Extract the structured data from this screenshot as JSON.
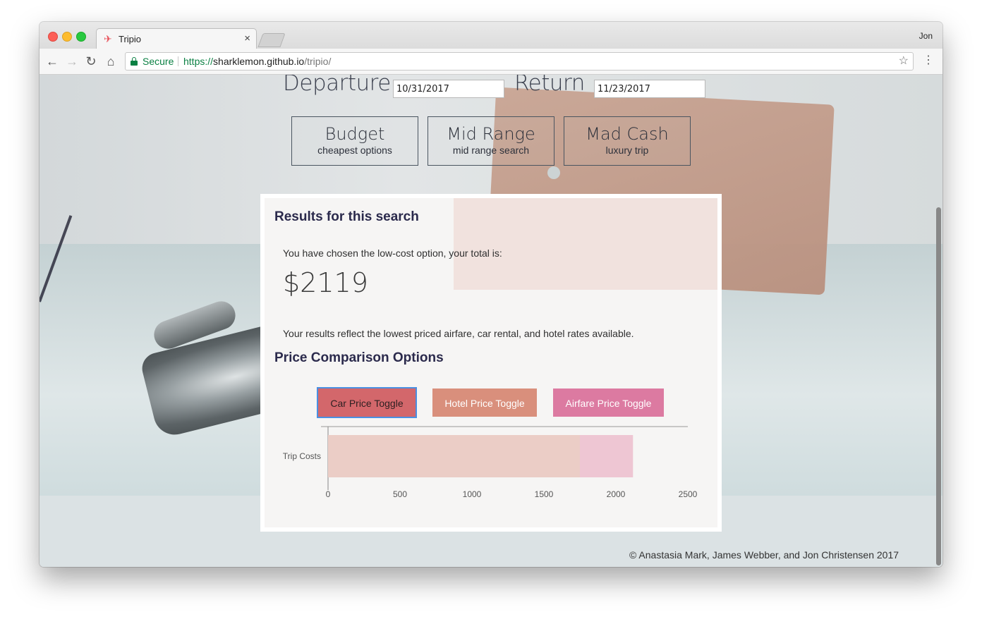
{
  "browser": {
    "tab_title": "Tripio",
    "profile": "Jon",
    "secure_label": "Secure",
    "url_scheme": "https://",
    "url_host": "sharklemon.github.io",
    "url_path": "/tripio/"
  },
  "search": {
    "departure_label": "Departure .",
    "departure_value": "10/31/2017",
    "return_label": "Return .",
    "return_value": "11/23/2017"
  },
  "tiers": [
    {
      "title": "Budget",
      "subtitle": "cheapest options"
    },
    {
      "title": "Mid Range",
      "subtitle": "mid range search"
    },
    {
      "title": "Mad Cash",
      "subtitle": "luxury trip"
    }
  ],
  "results": {
    "title": "Results for this search",
    "chosen_text": "You have chosen the low-cost option, your total is:",
    "total": "$2119",
    "note": "Your results reflect the lowest priced airfare, car rental, and hotel rates available.",
    "comparison_title": "Price Comparison Options",
    "toggles": [
      "Car Price Toggle",
      "Hotel Price Toggle",
      "Airfare Price Toggle"
    ]
  },
  "chart_data": {
    "type": "bar",
    "orientation": "horizontal",
    "stacked": true,
    "categories": [
      "Trip Costs"
    ],
    "series": [
      {
        "values": [
          1750
        ],
        "color": "#ebcdc6"
      },
      {
        "values": [
          369
        ],
        "color": "#eec6d3"
      }
    ],
    "xlim": [
      0,
      2500
    ],
    "xticks": [
      0,
      500,
      1000,
      1500,
      2000,
      2500
    ]
  },
  "footer": {
    "credit": "© Anastasia Mark, James Webber, and Jon Christensen 2017"
  },
  "colors": {
    "car_toggle": "#d3676b",
    "hotel_toggle": "#d98f7c",
    "airfare_toggle": "#dc7aa1",
    "heading": "#2b2a4c"
  }
}
